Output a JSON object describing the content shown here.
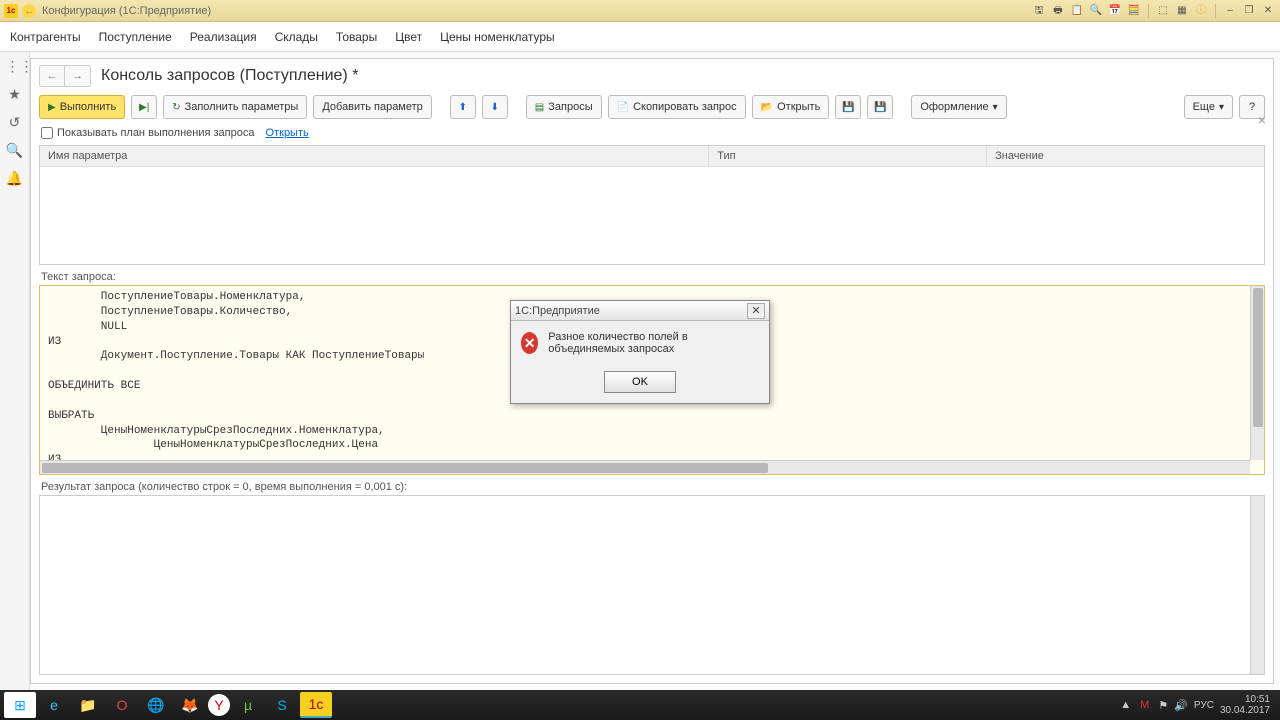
{
  "titlebar": {
    "text": "Конфигурация  (1С:Предприятие)"
  },
  "menubar": [
    "Контрагенты",
    "Поступление",
    "Реализация",
    "Склады",
    "Товары",
    "Цвет",
    "Цены номенклатуры"
  ],
  "page": {
    "title": "Консоль запросов (Поступление) *"
  },
  "toolbar": {
    "run": "Выполнить",
    "fill_params": "Заполнить параметры",
    "add_param": "Добавить параметр",
    "queries": "Запросы",
    "copy_query": "Скопировать запрос",
    "open": "Открыть",
    "format": "Оформление",
    "more": "Еще"
  },
  "options": {
    "show_plan": "Показывать план выполнения запроса",
    "open_link": "Открыть"
  },
  "params_headers": {
    "name": "Имя параметра",
    "type": "Тип",
    "value": "Значение"
  },
  "sections": {
    "query_label": "Текст запроса:",
    "result_label": "Результат запроса (количество строк = 0, время выполнения = 0,001 с):"
  },
  "query_text": "        ПоступлениеТовары.Номенклатура,\n        ПоступлениеТовары.Количество,\n        NULL\nИЗ\n        Документ.Поступление.Товары КАК ПоступлениеТовары\n\nОБЪЕДИНИТЬ ВСЕ\n\nВЫБРАТЬ\n        ЦеныНоменклатурыСрезПоследних.Номенклатура,\n                ЦеныНоменклатурыСрезПоследних.Цена\nИЗ\n        РегистрСведений.ЦеныНоменклатуры.СрезПоследних КАК ЦеныНоменклатурыСрезПоследних\nИТОГИ\n        СУММА(Количество)\nПО\n        Номенклатура",
  "dialog": {
    "title": "1С:Предприятие",
    "message": "Разное количество полей в объединяемых запросах",
    "ok": "OK"
  },
  "tray": {
    "lang": "РУС",
    "time": "10:51",
    "date": "30.04.2017"
  }
}
